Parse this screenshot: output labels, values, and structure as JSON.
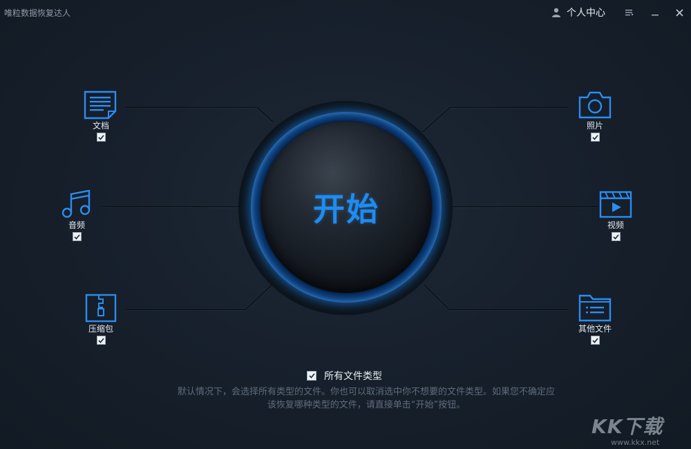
{
  "window": {
    "title": "唯粒数据恢复达人"
  },
  "header": {
    "user_label": "个人中心"
  },
  "categories": {
    "documents": {
      "label": "文档",
      "checked": true
    },
    "photos": {
      "label": "照片",
      "checked": true
    },
    "audio": {
      "label": "音频",
      "checked": true
    },
    "video": {
      "label": "视频",
      "checked": true
    },
    "archives": {
      "label": "压缩包",
      "checked": true
    },
    "other_files": {
      "label": "其他文件",
      "checked": true
    }
  },
  "start_button": {
    "label": "开始"
  },
  "all_types": {
    "label": "所有文件类型",
    "checked": true
  },
  "hint": {
    "line1": "默认情况下，会选择所有类型的文件。你也可以取消选中你不想要的文件类型。如果您不确定应",
    "line2": "该恢复哪种类型的文件，请直接单击“开始”按钮。"
  },
  "watermark": {
    "big": "KK下载",
    "small": "www.kkx.net"
  },
  "colors": {
    "accent": "#1f8cf0",
    "icon": "#2b8df0",
    "background": "#17202c"
  },
  "icons": [
    "user-icon",
    "menu-icon",
    "minimize-icon",
    "close-icon",
    "document-icon",
    "camera-icon",
    "music-icon",
    "video-icon",
    "zip-icon",
    "folder-icon",
    "check-icon"
  ]
}
